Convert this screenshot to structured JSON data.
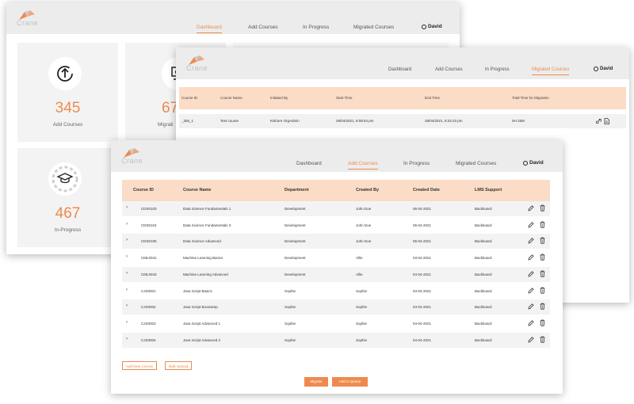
{
  "colors": {
    "accent": "#ef8a4e",
    "header": "#ececec",
    "table_header": "#fbdcc6"
  },
  "back_window": {
    "brand": "Crane",
    "nav": [
      "Dashboard",
      "Add Courses",
      "In Progress",
      "Migrated Courses"
    ],
    "active_nav": "Dashboard",
    "user": "David",
    "cards": [
      {
        "value": "345",
        "label": "Add Courses",
        "icon": "upload-arrow-icon"
      },
      {
        "value": "67",
        "label": "Migrati",
        "icon": "migrate-icon"
      },
      {
        "value": "467",
        "label": "In-Progress",
        "icon": "graduation-cap-icon"
      }
    ]
  },
  "migrated_window": {
    "brand": "Crane",
    "nav": [
      "Dashboard",
      "Add Courses",
      "In Progress",
      "Migrated Courses"
    ],
    "active_nav": "Migrated Courses",
    "user": "David",
    "columns": [
      "Course ID",
      "Course Name",
      "Initiated By",
      "Start Time",
      "End Time",
      "Total Time for Migration"
    ],
    "rows": [
      [
        "_355_1",
        "Test course",
        "Kishore OrgAdmin",
        "28/04/2021, 8:08:54 pm",
        "28/04/2021, 8:24:23 pm",
        "0H:15M"
      ]
    ]
  },
  "add_courses_window": {
    "brand": "Crane",
    "nav": [
      "Dashboard",
      "Add Courses",
      "In Progress",
      "Migrated Courses"
    ],
    "active_nav": "Add Courses",
    "user": "David",
    "columns": [
      "Course ID",
      "Course Name",
      "Department",
      "Created By",
      "Created Date",
      "LMS Support"
    ],
    "rows": [
      [
        "CDS0103",
        "Data Science Fundamentals 1",
        "Development",
        "John Doe",
        "06-04-2021",
        "Backboard"
      ],
      [
        "CDS0104",
        "Data Science Fundamentals 3",
        "Development",
        "John Doe",
        "06-04-2021",
        "Backboard"
      ],
      [
        "CDS0105",
        "Data Science Advanced",
        "Development",
        "John Doe",
        "06-04-2021",
        "Backboard"
      ],
      [
        "CML0041",
        "Machine Learning Basics",
        "Development",
        "Allie",
        "03-04-2021",
        "Backboard"
      ],
      [
        "CML0043",
        "Machine Learning Advanced",
        "Development",
        "Allie",
        "04-04-2021",
        "Backboard"
      ],
      [
        "CJS0001",
        "Java Script Basics",
        "Sophie",
        "Sophie",
        "04-04-2021",
        "Backboard"
      ],
      [
        "CJS0002",
        "Java Script Bootcamp",
        "Sophie",
        "Sophie",
        "04-04-2021",
        "Backboard"
      ],
      [
        "CJS0003",
        "Java Script Advanced 1",
        "Sophie",
        "Sophie",
        "04-04-2021",
        "Backboard"
      ],
      [
        "CJS0004",
        "Java Script Advanced 2",
        "Sophie",
        "Sophie",
        "04-04-2021",
        "Backboard"
      ]
    ],
    "add_new_label": "Add New Course",
    "bulk_upload_label": "Bulk Upload",
    "migrate_label": "Migrate",
    "queue_label": "Add to Queue"
  }
}
